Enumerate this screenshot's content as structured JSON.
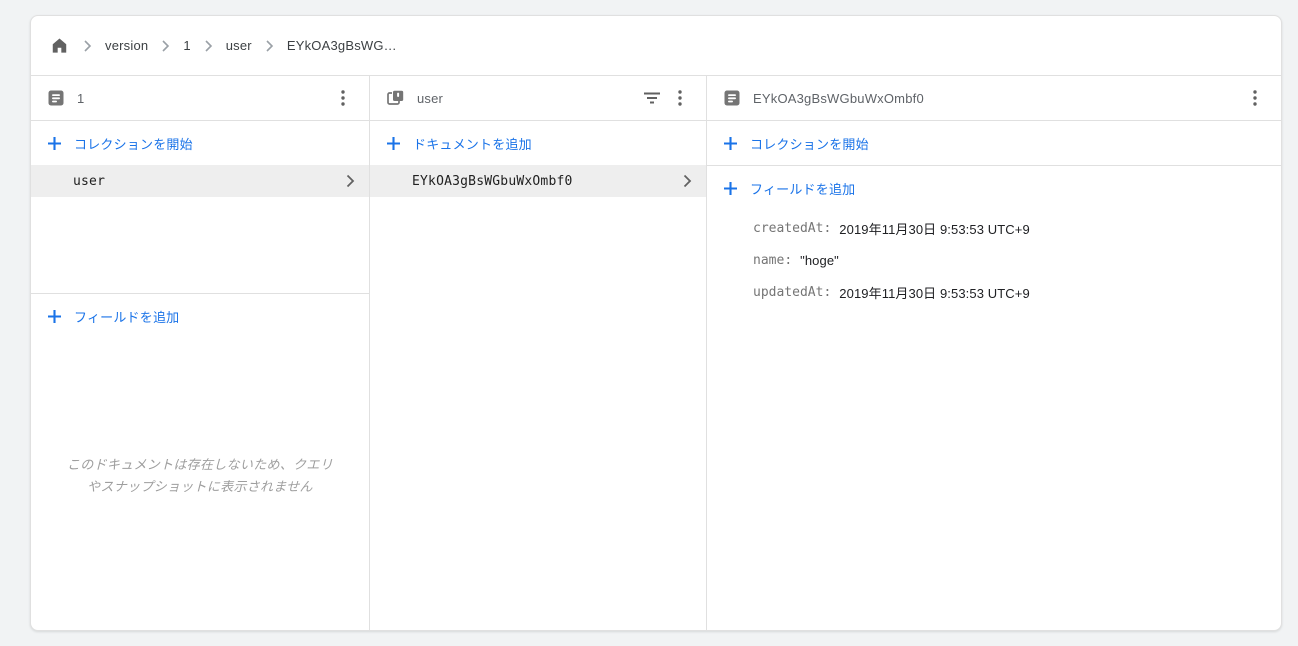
{
  "labels": {
    "colon": ":"
  },
  "icons": [
    "home-icon",
    "chevron-right-icon",
    "document-icon",
    "collection-icon",
    "filter-icon",
    "kebab-menu-icon",
    "plus-icon"
  ],
  "colors": {
    "accent_blue": "#1a73e8",
    "selected_row_bg": "#eeeeee",
    "icon_gray": "#616161",
    "header_text": "#5f6368",
    "note_gray": "#9e9e9e"
  },
  "breadcrumb": {
    "items": [
      {
        "label": "version"
      },
      {
        "label": "1"
      },
      {
        "label": "user"
      },
      {
        "label": "EYkOA3gBsWG…"
      }
    ]
  },
  "panel1": {
    "title": "1",
    "start_collection_label": "コレクションを開始",
    "collection_row_label": "user",
    "add_field_label": "フィールドを追加",
    "note": "このドキュメントは存在しないため、クエリやスナップショットに表示されません"
  },
  "panel2": {
    "title": "user",
    "add_document_label": "ドキュメントを追加",
    "document_row_label": "EYkOA3gBsWGbuWxOmbf0"
  },
  "panel3": {
    "title": "EYkOA3gBsWGbuWxOmbf0",
    "start_collection_label": "コレクションを開始",
    "add_field_label": "フィールドを追加",
    "fields": [
      {
        "name": "createdAt",
        "value": "2019年11月30日 9:53:53 UTC+9"
      },
      {
        "name": "name",
        "value": "\"hoge\""
      },
      {
        "name": "updatedAt",
        "value": "2019年11月30日 9:53:53 UTC+9"
      }
    ]
  }
}
